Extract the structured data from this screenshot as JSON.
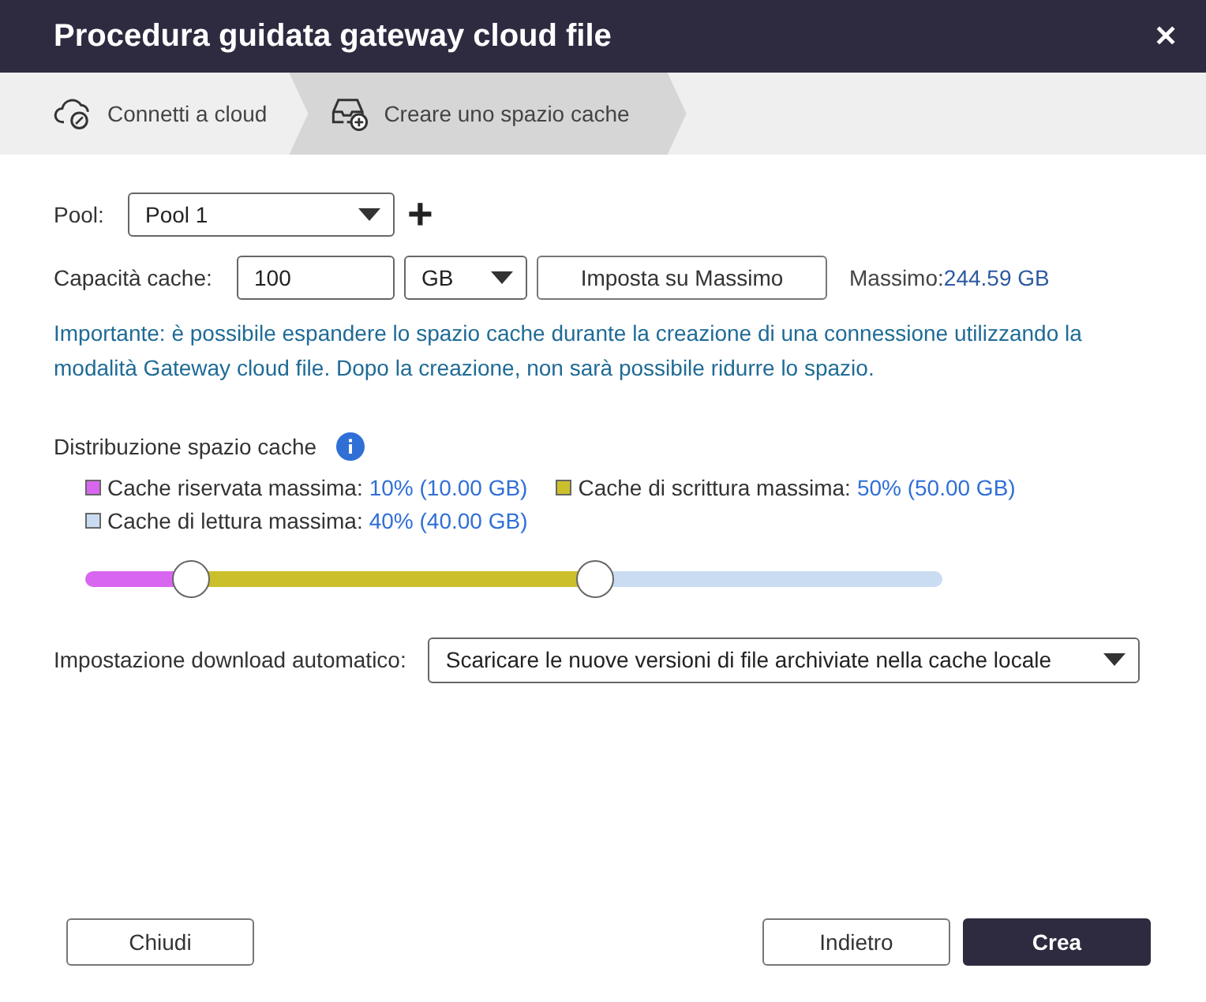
{
  "window": {
    "title": "Procedura guidata gateway cloud file",
    "close": "✕"
  },
  "steps": [
    {
      "label": "Connetti a cloud",
      "kind": "cloud",
      "selected": false
    },
    {
      "label": "Creare uno spazio cache",
      "kind": "storage",
      "selected": true
    }
  ],
  "pool": {
    "label": "Pool:",
    "value": "Pool 1",
    "add": "+"
  },
  "capacity": {
    "label": "Capacità cache:",
    "value": "100",
    "unit": "GB",
    "max_button": "Imposta su Massimo",
    "max_label": "Massimo:",
    "max_value": "244.59 GB"
  },
  "notice": "Importante: è possibile espandere lo spazio cache durante la creazione di una connessione utilizzando la modalità Gateway cloud file. Dopo la creazione, non sarà possibile ridurre lo spazio.",
  "distribution": {
    "title": "Distribuzione spazio cache",
    "legend": [
      {
        "label": "Cache riservata massima:",
        "value": "10% (10.00 GB)",
        "color": "#d966f0"
      },
      {
        "label": "Cache di scrittura massima:",
        "value": "50% (50.00 GB)",
        "color": "#ccbf2c"
      },
      {
        "label": "Cache di lettura massima:",
        "value": "40% (40.00 GB)",
        "color": "#c9dcf2"
      }
    ],
    "thumbs": [
      {
        "level": 0.1
      },
      {
        "level": 0.6
      }
    ]
  },
  "auto_download": {
    "label": "Impostazione download automatico:",
    "value": "Scaricare le nuove versioni di file archiviate nella cache locale"
  },
  "buttons": [
    {
      "label": "Chiudi",
      "kind": "secondary"
    },
    {
      "label": "Indietro",
      "kind": "secondary"
    },
    {
      "label": "Crea",
      "kind": "primary"
    }
  ]
}
